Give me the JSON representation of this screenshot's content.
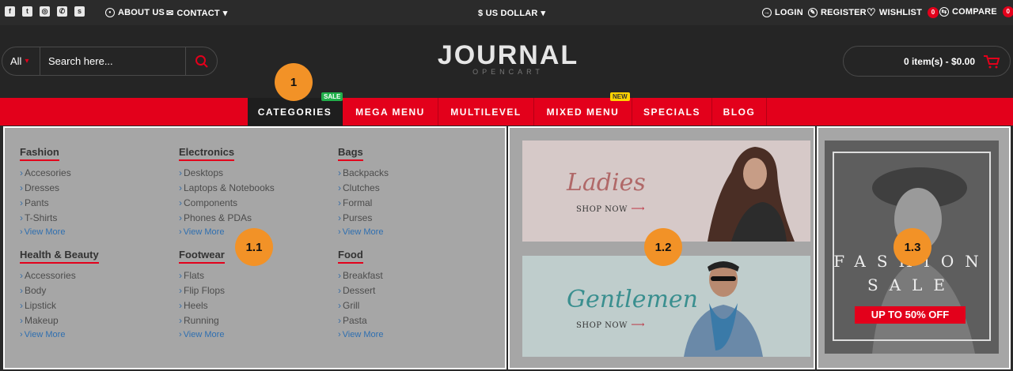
{
  "topbar": {
    "social_icons": [
      "facebook-icon",
      "twitter-icon",
      "instagram-icon",
      "whatsapp-icon",
      "skype-icon"
    ],
    "about": "ABOUT US",
    "contact": "CONTACT",
    "currency": "$ US DOLLAR",
    "login": "LOGIN",
    "register": "REGISTER",
    "wishlist": "WISHLIST",
    "wishlist_count": "0",
    "compare": "COMPARE",
    "compare_count": "0"
  },
  "header": {
    "search_category": "All",
    "search_placeholder": "Search here...",
    "logo": "JOURNAL",
    "logo_sub": "OPENCART",
    "cart": "0 item(s) - $0.00"
  },
  "nav": {
    "items": [
      {
        "label": "CATEGORIES",
        "tag": "SALE"
      },
      {
        "label": "MEGA MENU",
        "tag": ""
      },
      {
        "label": "MULTILEVEL",
        "tag": ""
      },
      {
        "label": "MIXED MENU",
        "tag": "NEW"
      },
      {
        "label": "SPECIALS",
        "tag": ""
      },
      {
        "label": "BLOG",
        "tag": ""
      }
    ]
  },
  "categories": [
    {
      "title": "Fashion",
      "items": [
        "Accesories",
        "Dresses",
        "Pants",
        "T-Shirts"
      ],
      "more": "View More"
    },
    {
      "title": "Electronics",
      "items": [
        "Desktops",
        "Laptops & Notebooks",
        "Components",
        "Phones & PDAs"
      ],
      "more": "View More"
    },
    {
      "title": "Bags",
      "items": [
        "Backpacks",
        "Clutches",
        "Formal",
        "Purses"
      ],
      "more": "View More"
    },
    {
      "title": "Health & Beauty",
      "items": [
        "Accessories",
        "Body",
        "Lipstick",
        "Makeup"
      ],
      "more": "View More"
    },
    {
      "title": "Footwear",
      "items": [
        "Flats",
        "Flip Flops",
        "Heels",
        "Running"
      ],
      "more": "View More"
    },
    {
      "title": "Food",
      "items": [
        "Breakfast",
        "Dessert",
        "Grill",
        "Pasta"
      ],
      "more": "View More"
    }
  ],
  "banners": {
    "ladies": {
      "title": "Ladies",
      "cta": "SHOP NOW"
    },
    "gentlemen": {
      "title": "Gentlemen",
      "cta": "SHOP NOW"
    },
    "fashion_sale": {
      "title": "FASHION SALE",
      "offer": "UP TO 50% OFF"
    }
  },
  "markers": [
    "1",
    "1.1",
    "1.2",
    "1.3"
  ],
  "colors": {
    "accent": "#e3001b",
    "marker": "#f29227",
    "dark": "#252525"
  }
}
